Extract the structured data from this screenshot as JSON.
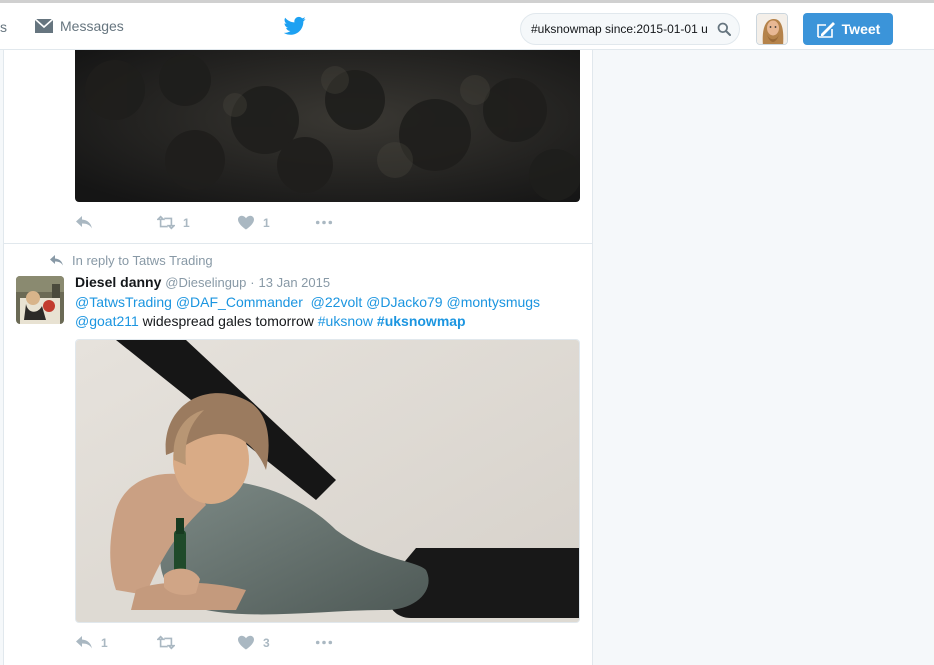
{
  "nav": {
    "fragment_label": "s",
    "messages_label": "Messages",
    "bird_icon": "twitter-bird-icon"
  },
  "search": {
    "value": "#uksnowmap since:2015-01-01 u",
    "icon": "search-icon"
  },
  "tweet_button": {
    "label": "Tweet",
    "icon": "compose-icon"
  },
  "colors": {
    "accent": "#1da1f2",
    "tweet_button": "#3b94d9",
    "muted": "#aab8c2",
    "link": "#1b95e0"
  },
  "tweets": [
    {
      "actions": {
        "reply_count": "",
        "retweet_count": "1",
        "like_count": "1"
      }
    },
    {
      "reply_context": "In reply to Tatws Trading",
      "fullname": "Diesel danny",
      "username": "@Dieselingup",
      "separator": "·",
      "timestamp": "13 Jan 2015",
      "text_parts": {
        "m1": "@TatwsTrading",
        "m2": "@DAF_Commander",
        "m3": "@22volt",
        "m4": "@DJacko79",
        "m5": "@montysmugs",
        "m6": "@goat211",
        "plain": " widespread gales tomorrow ",
        "h1": "#uksnow",
        "h2": "#uksnowmap"
      },
      "actions": {
        "reply_count": "1",
        "retweet_count": "",
        "like_count": "3"
      }
    }
  ]
}
